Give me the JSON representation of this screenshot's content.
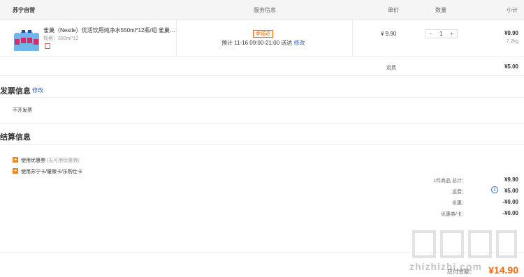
{
  "header": {
    "store": "苏宁自营",
    "service": "服务信息",
    "unit_price": "单价",
    "quantity": "数量",
    "subtotal": "小计"
  },
  "product": {
    "title": "雀巢（Nestle）优活饮用纯净水550ml*12瓶/组 雀巢…",
    "spec": "规格：550ml*12",
    "badge": "承诺达",
    "delivery": "预计 11-16 09:00-21:00  送达",
    "delivery_edit": "修改",
    "price": "¥ 9.90",
    "qty": "1",
    "minus": "−",
    "plus": "+",
    "subtotal": "¥9.90",
    "weight": "7.2kg"
  },
  "shipping": {
    "label": "运费",
    "value": "¥5.00"
  },
  "invoice": {
    "title": "发票信息",
    "edit": "修改",
    "value": "不开发票"
  },
  "settlement": {
    "title": "结算信息",
    "coupon_label": "使用优惠券",
    "coupon_note": "(无可用优惠券)",
    "card_label": "使用苏宁卡/量贩卡/乐购仕卡",
    "summary": [
      {
        "label": "1件商品 总计：",
        "value": "¥9.90"
      },
      {
        "label": "运费：",
        "value": "¥5.00"
      },
      {
        "label": "优惠：",
        "value": "-¥0.00"
      },
      {
        "label": "优惠券/卡：",
        "value": "-¥0.00"
      }
    ],
    "total_label": "应付金额：",
    "total_value": "¥14.90"
  },
  "watermark": {
    "text": "zhizhizhi.com"
  },
  "colors": {
    "accent": "#ff6600",
    "link": "#2b65c9",
    "plus_icon": "#f08a24"
  }
}
